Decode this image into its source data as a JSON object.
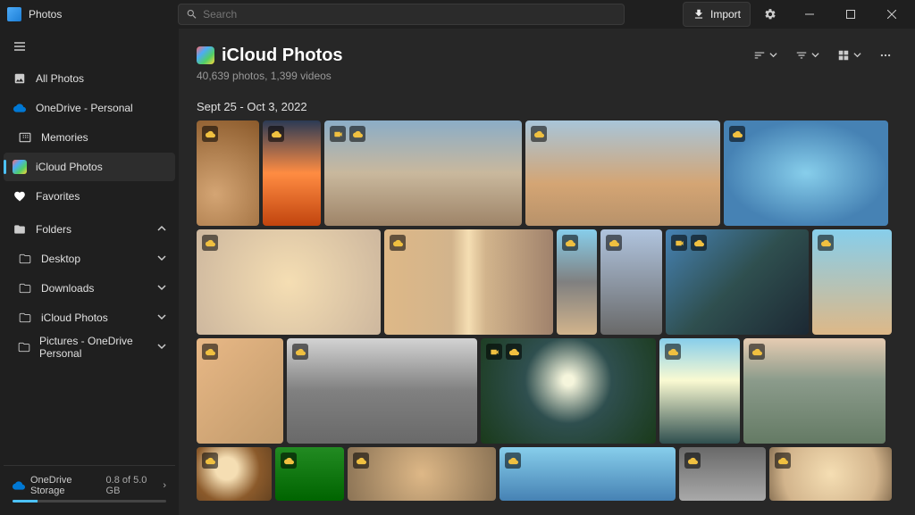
{
  "app": {
    "title": "Photos",
    "search_placeholder": "Search",
    "import_label": "Import"
  },
  "sidebar": {
    "all_photos": "All Photos",
    "onedrive": "OneDrive - Personal",
    "memories": "Memories",
    "icloud": "iCloud Photos",
    "favorites": "Favorites",
    "folders_label": "Folders",
    "folders": {
      "desktop": "Desktop",
      "downloads": "Downloads",
      "icloud_photos": "iCloud Photos",
      "pictures_onedrive": "Pictures - OneDrive Personal"
    },
    "storage": {
      "service": "OneDrive Storage",
      "used": "0.8 of 5.0 GB",
      "percent": 16
    }
  },
  "main": {
    "title": "iCloud Photos",
    "subtitle": "40,639 photos, 1,399 videos",
    "date_range": "Sept 25 - Oct 3, 2022"
  }
}
